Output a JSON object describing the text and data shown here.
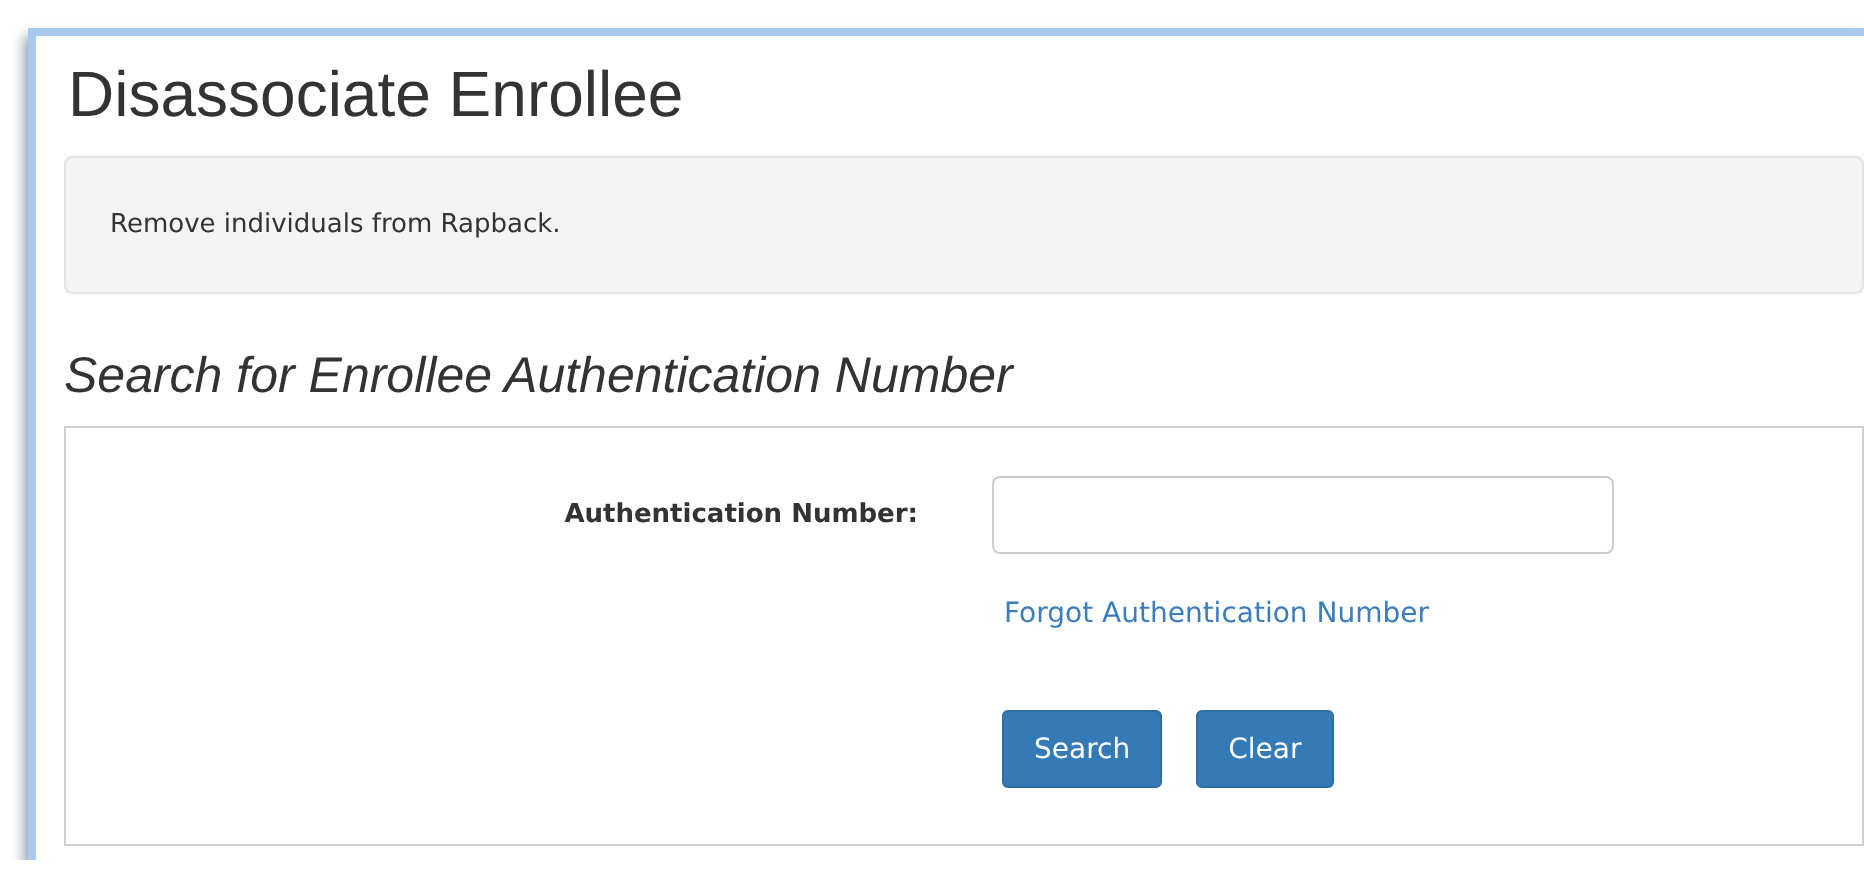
{
  "page": {
    "title": "Disassociate Enrollee"
  },
  "notice": {
    "text": "Remove individuals from Rapback."
  },
  "search_section": {
    "heading": "Search for Enrollee Authentication Number",
    "field": {
      "label": "Authentication Number:"
    },
    "forgot_link": "Forgot Authentication Number",
    "buttons": [
      {
        "label": "Search",
        "kind": "primary"
      },
      {
        "label": "Clear",
        "kind": "primary"
      }
    ]
  }
}
